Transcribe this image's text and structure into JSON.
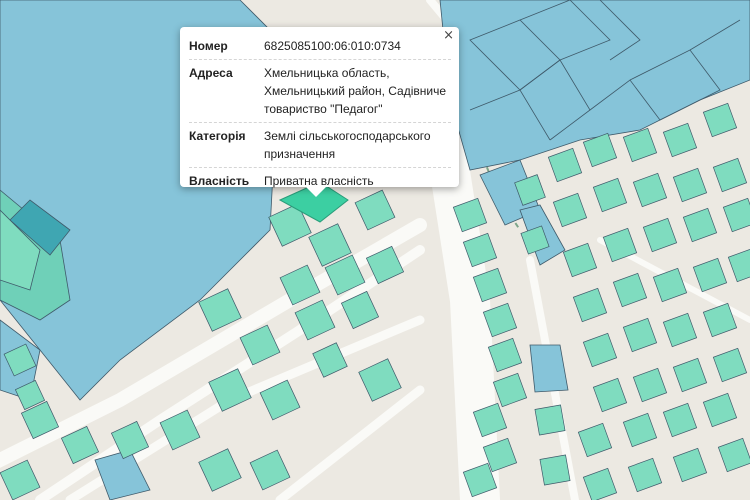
{
  "map": {
    "colors": {
      "background": "#ece9e2",
      "road": "#fafaf7",
      "parcel_green": "#7fdcbf",
      "parcel_blue": "#86c4d9",
      "parcel_selected": "#3ccfa2",
      "outline": "#3f5a6a"
    }
  },
  "popup": {
    "close_label": "×",
    "rows": [
      {
        "key": "Номер",
        "value": "6825085100:06:010:0734"
      },
      {
        "key": "Адреса",
        "value": "Хмельницька область, Хмельницький район, Садівниче товариство \"Педагог\""
      },
      {
        "key": "Категорія",
        "value": "Землі сільськогосподарського призначення"
      },
      {
        "key": "Власність",
        "value": "Приватна власність"
      }
    ]
  }
}
